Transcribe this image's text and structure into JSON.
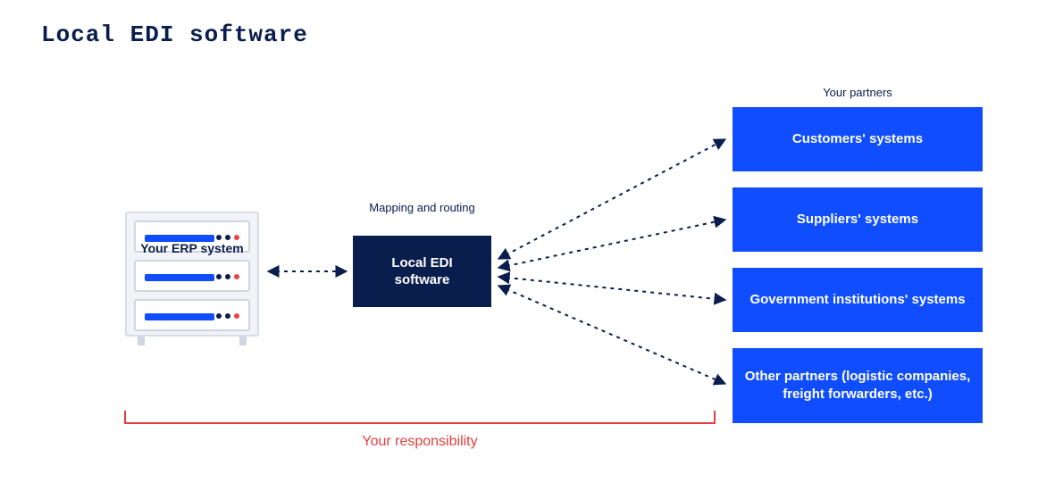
{
  "title": "Local EDI software",
  "erp_label": "Your ERP system",
  "center": {
    "caption": "Mapping and routing",
    "box": "Local EDI\nsoftware"
  },
  "partners_header": "Your partners",
  "partners": [
    "Customers' systems",
    "Suppliers' systems",
    "Government institutions' systems",
    "Other partners (logistic companies, freight forwarders, etc.)"
  ],
  "responsibility": "Your responsibility",
  "colors": {
    "navy": "#0a1e4e",
    "blue": "#0f4dff",
    "red": "#e53e3e",
    "grey": "#f1f3f7"
  }
}
